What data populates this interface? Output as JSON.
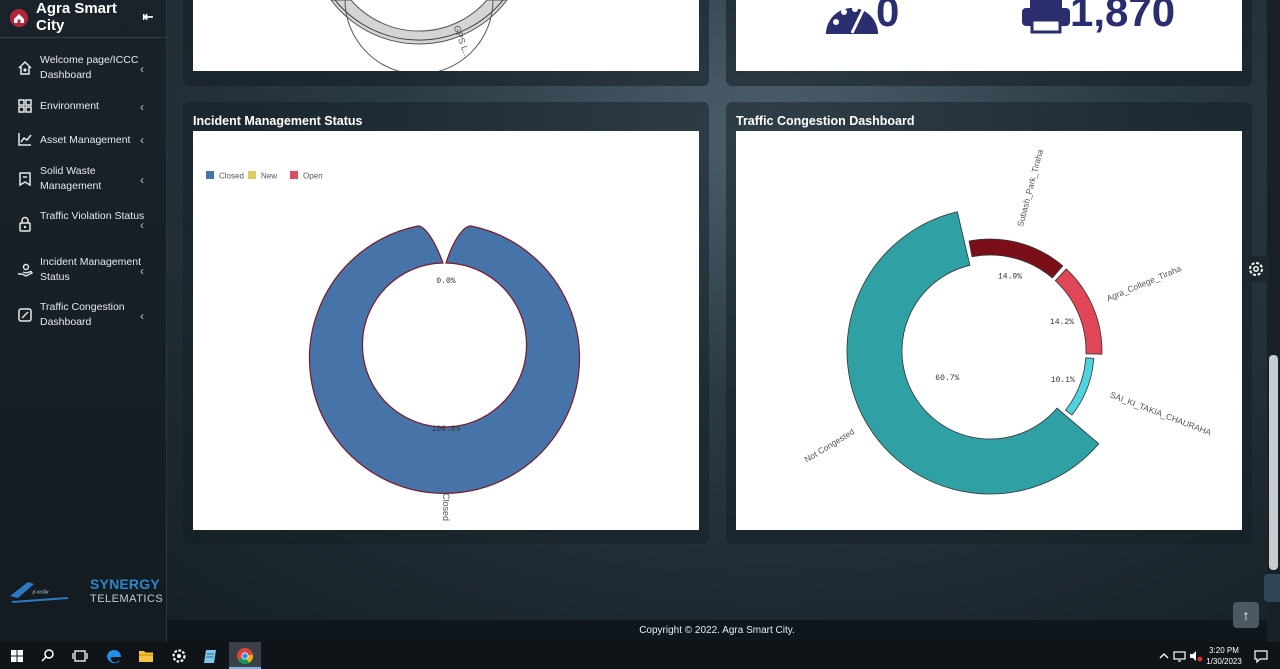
{
  "app": {
    "title": "Agra Smart City",
    "collapse_icon": "collapse-left-icon"
  },
  "sidebar": {
    "items": [
      {
        "label": "Welcome page/ICCC Dashboard",
        "icon": "home-icon"
      },
      {
        "label": "Environment",
        "icon": "grid-icon"
      },
      {
        "label": "Asset Management",
        "icon": "line-chart-icon"
      },
      {
        "label": "Solid Waste Management",
        "icon": "bookmark-icon"
      },
      {
        "label": "Traffic Violation Status",
        "icon": "lock-icon"
      },
      {
        "label": "Incident Management Status",
        "icon": "hand-care-icon"
      },
      {
        "label": "Traffic Congestion Dashboard",
        "icon": "pen-square-icon"
      }
    ],
    "partner": {
      "line1": "SYNERGY",
      "line2": "TELEMATICS"
    }
  },
  "top_panels": {
    "left_chart_label": "GPS L...",
    "right_value_left": "0",
    "right_value_right": "1,870"
  },
  "incident_panel": {
    "title": "Incident Management Status",
    "chart_data": {
      "type": "pie",
      "subtype": "donut",
      "legend": [
        {
          "name": "Closed",
          "color": "#4674a8"
        },
        {
          "name": "New",
          "color": "#e0c960"
        },
        {
          "name": "Open",
          "color": "#d65060"
        }
      ],
      "legend_position": "top-left",
      "slices": [
        {
          "name": "Closed",
          "value": 100.0,
          "label": "100.0%"
        },
        {
          "name": "New",
          "value": 0.0,
          "label": "0.0%"
        },
        {
          "name": "Open",
          "value": 0.0,
          "label": ""
        }
      ],
      "slice_label": "Closed"
    }
  },
  "traffic_panel": {
    "title": "Traffic Congestion Dashboard",
    "chart_data": {
      "type": "pie",
      "subtype": "donut",
      "slices": [
        {
          "name": "Not Congested",
          "value": 60.7,
          "label": "60.7%",
          "color": "#2fa0a4"
        },
        {
          "name": "Subash_Park_Tiraha",
          "value": 14.9,
          "label": "14.9%",
          "color": "#7a0f1a"
        },
        {
          "name": "Agra_College_Tiraha",
          "value": 14.2,
          "label": "14.2%",
          "color": "#e04658"
        },
        {
          "name": "SAI_KI_TAKIA_CHAURAHA",
          "value": 10.1,
          "label": "10.1%",
          "color": "#4fd3e0"
        }
      ]
    }
  },
  "footer": {
    "text": "Copyright © 2022. Agra Smart City."
  },
  "taskbar": {
    "time": "3:20 PM",
    "date": "1/30/2023",
    "icons": [
      "windows-start-icon",
      "search-icon",
      "task-view-icon",
      "edge-icon",
      "file-explorer-icon",
      "settings-icon",
      "notepad-icon",
      "chrome-icon"
    ]
  }
}
